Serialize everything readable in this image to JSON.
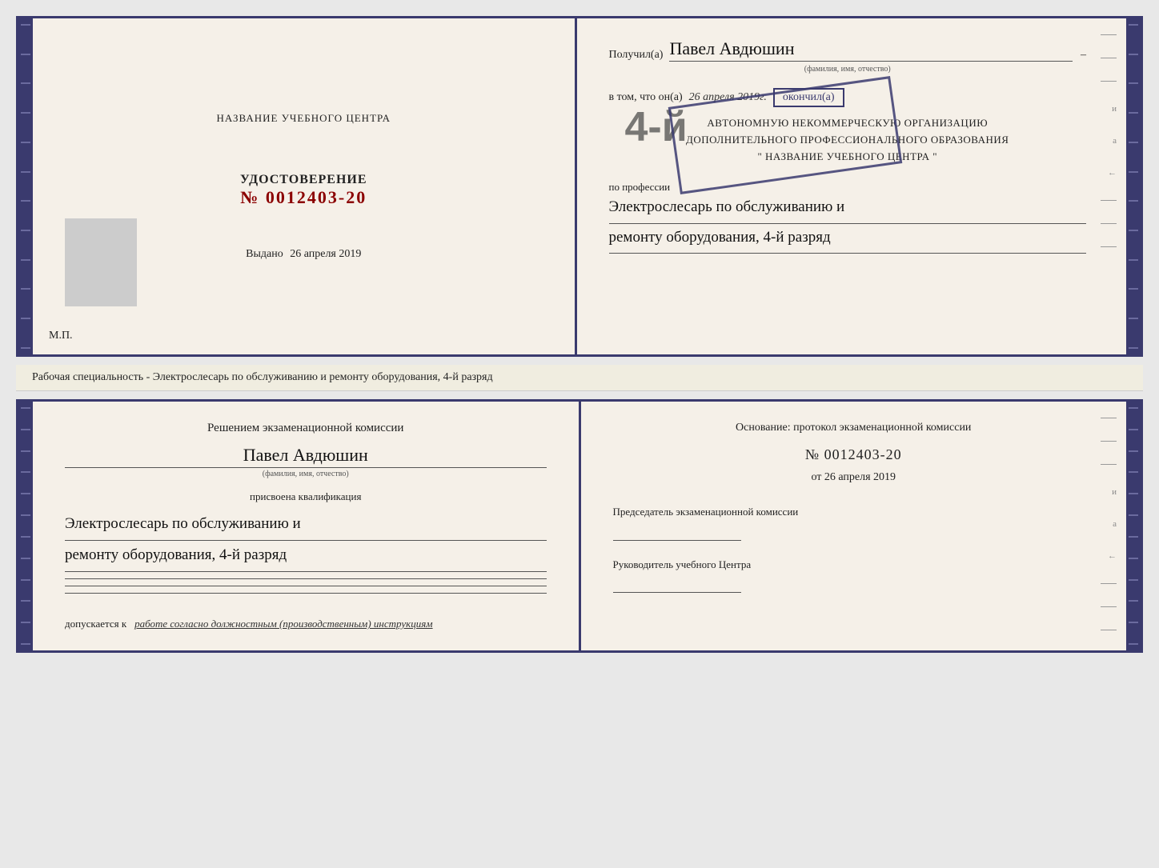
{
  "cert_top": {
    "left": {
      "title": "НАЗВАНИЕ УЧЕБНОГО ЦЕНТРА",
      "udostoverenie_label": "УДОСТОВЕРЕНИЕ",
      "number_prefix": "№",
      "number": "0012403-20",
      "vydano_label": "Выдано",
      "vydano_date": "26 апреля 2019",
      "mp_label": "М.П."
    },
    "right": {
      "poluchil_label": "Получил(а)",
      "name": "Павел Авдюшин",
      "fio_small": "(фамилия, имя, отчество)",
      "vtom_label": "в том, что он(а)",
      "date_handwritten": "26 апреля 2019г.",
      "okoncil_label": "окончил(а)",
      "rank_big": "4-й",
      "org_line1": "АВТОНОМНУЮ НЕКОММЕРЧЕСКУЮ ОРГАНИЗАЦИЮ",
      "org_line2": "ДОПОЛНИТЕЛЬНОГО ПРОФЕССИОНАЛЬНОГО ОБРАЗОВАНИЯ",
      "org_line3": "\" НАЗВАНИЕ УЧЕБНОГО ЦЕНТРА \"",
      "po_professii_label": "по профессии",
      "profession_line1": "Электрослесарь по обслуживанию и",
      "profession_line2": "ремонту оборудования, 4-й разряд"
    }
  },
  "specialty_text": "Рабочая специальность - Электрослесарь по обслуживанию и ремонту оборудования, 4-й разряд",
  "cert_bottom": {
    "left": {
      "resheniem_label": "Решением экзаменационной комиссии",
      "name": "Павел Авдюшин",
      "fio_small": "(фамилия, имя, отчество)",
      "prisvoena_label": "присвоена квалификация",
      "prof_line1": "Электрослесарь по обслуживанию и",
      "prof_line2": "ремонту оборудования, 4-й разряд",
      "dopuskaetsya_label": "допускается к",
      "dopuskaetsya_value": "работе согласно должностным (производственным) инструкциям"
    },
    "right": {
      "osnovaniye_label": "Основание: протокол экзаменационной комиссии",
      "number_prefix": "№",
      "number": "0012403-20",
      "ot_prefix": "от",
      "ot_date": "26 апреля 2019",
      "predsedatel_label": "Председатель экзаменационной комиссии",
      "rukovoditel_label": "Руководитель учебного Центра"
    }
  },
  "edge_decorations": {
    "right_chars": [
      "–",
      "–",
      "–",
      "и",
      "а",
      "←",
      "–",
      "–",
      "–"
    ]
  }
}
